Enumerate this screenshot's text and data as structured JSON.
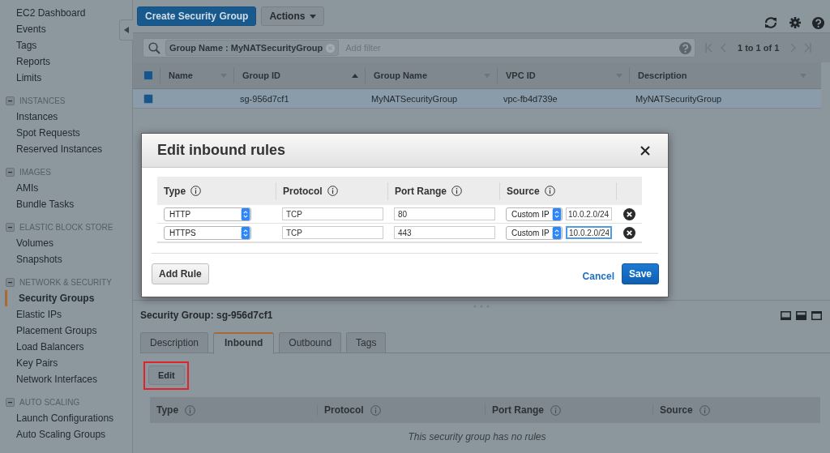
{
  "sidebar": {
    "sections": [
      {
        "items": [
          {
            "label": "EC2 Dashboard",
            "selected": false
          },
          {
            "label": "Events",
            "selected": false
          },
          {
            "label": "Tags",
            "selected": false
          },
          {
            "label": "Reports",
            "selected": false
          },
          {
            "label": "Limits",
            "selected": false
          }
        ]
      },
      {
        "title": "INSTANCES",
        "expanded": true,
        "items": [
          {
            "label": "Instances",
            "selected": false
          },
          {
            "label": "Spot Requests",
            "selected": false
          },
          {
            "label": "Reserved Instances",
            "selected": false
          }
        ]
      },
      {
        "title": "IMAGES",
        "expanded": true,
        "items": [
          {
            "label": "AMIs",
            "selected": false
          },
          {
            "label": "Bundle Tasks",
            "selected": false
          }
        ]
      },
      {
        "title": "ELASTIC BLOCK STORE",
        "expanded": true,
        "items": [
          {
            "label": "Volumes",
            "selected": false
          },
          {
            "label": "Snapshots",
            "selected": false
          }
        ]
      },
      {
        "title": "NETWORK & SECURITY",
        "expanded": true,
        "items": [
          {
            "label": "Security Groups",
            "selected": true
          },
          {
            "label": "Elastic IPs",
            "selected": false
          },
          {
            "label": "Placement Groups",
            "selected": false
          },
          {
            "label": "Load Balancers",
            "selected": false
          },
          {
            "label": "Key Pairs",
            "selected": false
          },
          {
            "label": "Network Interfaces",
            "selected": false
          }
        ]
      },
      {
        "title": "AUTO SCALING",
        "expanded": true,
        "items": [
          {
            "label": "Launch Configurations",
            "selected": false
          },
          {
            "label": "Auto Scaling Groups",
            "selected": false
          }
        ]
      }
    ]
  },
  "toolbar": {
    "buttons": [
      {
        "label": "Create Security Group",
        "kind": "primary"
      },
      {
        "label": "Actions",
        "kind": "dropdown"
      }
    ]
  },
  "filter": {
    "tokens": [
      {
        "label": "Group Name : MyNATSecurityGroup"
      }
    ],
    "placeholder": "Add filter",
    "pagination": "1 to 1 of 1"
  },
  "table": {
    "all_checked": true,
    "columns": [
      {
        "label": "Name",
        "sorted": false
      },
      {
        "label": "Group ID",
        "sorted": true
      },
      {
        "label": "Group Name",
        "sorted": false
      },
      {
        "label": "VPC ID",
        "sorted": false
      },
      {
        "label": "Description",
        "sorted": false
      }
    ],
    "rows": [
      {
        "selected": true,
        "checked": true,
        "group_id": "sg-956d7cf1",
        "group_name": "MyNATSecurityGroup",
        "vpc_id": "vpc-fb4d739e",
        "description": "MyNATSecurityGroup"
      }
    ]
  },
  "modal": {
    "title": "Edit inbound rules",
    "columns": [
      "Type",
      "Protocol",
      "Port Range",
      "Source"
    ],
    "rules": [
      {
        "type": "HTTP",
        "protocol": "TCP",
        "port_range": "80",
        "source": "Custom IP",
        "cidr": "10.0.2.0/24",
        "focused": false
      },
      {
        "type": "HTTPS",
        "protocol": "TCP",
        "port_range": "443",
        "source": "Custom IP",
        "cidr": "10.0.2.0/24",
        "focused": true
      }
    ],
    "add_button": "Add Rule",
    "cancel": "Cancel",
    "save": "Save"
  },
  "detail": {
    "title": "Security Group: sg-956d7cf1",
    "tabs": [
      {
        "label": "Description",
        "selected": false
      },
      {
        "label": "Inbound",
        "selected": true
      },
      {
        "label": "Outbound",
        "selected": false
      },
      {
        "label": "Tags",
        "selected": false
      }
    ],
    "edit_button": "Edit",
    "columns": [
      "Type",
      "Protocol",
      "Port Range",
      "Source"
    ],
    "empty_message": "This security group has no rules"
  }
}
